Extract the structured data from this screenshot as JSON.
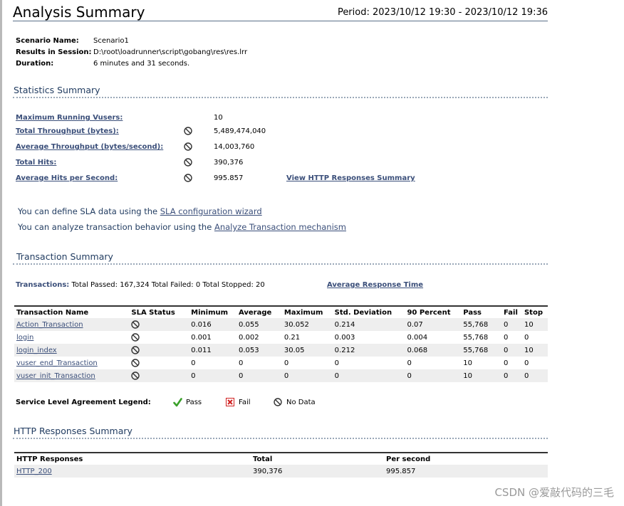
{
  "header": {
    "title": "Analysis Summary",
    "period": "Period: 2023/10/12 19:30 - 2023/10/12 19:36"
  },
  "scenario": {
    "name_label": "Scenario Name:",
    "name_value": "Scenario1",
    "session_label": "Results in Session:",
    "session_value": "D:\\root\\loadrunner\\script\\gobang\\res\\res.lrr",
    "duration_label": "Duration:",
    "duration_value": "6 minutes and 31 seconds."
  },
  "statistics": {
    "heading": "Statistics Summary",
    "items": [
      {
        "label": "Maximum Running Vusers:",
        "value": "10",
        "sla": false
      },
      {
        "label": "Total Throughput (bytes):",
        "value": "5,489,474,040",
        "sla": true
      },
      {
        "label": "Average Throughput (bytes/second):",
        "value": "14,003,760",
        "sla": true
      },
      {
        "label": "Total Hits:",
        "value": "390,376",
        "sla": true
      },
      {
        "label": "Average Hits per Second:",
        "value": "995.857",
        "sla": true
      }
    ],
    "http_link": "View HTTP Responses Summary"
  },
  "sla_info": {
    "line1_text": "You can define SLA data using the ",
    "line1_link": "SLA configuration wizard",
    "line2_text": "You can analyze transaction behavior using the ",
    "line2_link": "Analyze Transaction mechanism"
  },
  "transactions": {
    "heading": "Transaction Summary",
    "link": "Transactions:",
    "totals": " Total Passed: 167,324 Total Failed: 0 Total Stopped: 20",
    "avg_response_link": "Average Response Time",
    "columns": [
      "Transaction Name",
      "SLA Status",
      "Minimum",
      "Average",
      "Maximum",
      "Std. Deviation",
      "90 Percent",
      "Pass",
      "Fail",
      "Stop"
    ],
    "rows": [
      [
        "Action_Transaction",
        "",
        "0.016",
        "0.055",
        "30.052",
        "0.214",
        "0.07",
        "55,768",
        "0",
        "10"
      ],
      [
        "login",
        "",
        "0.001",
        "0.002",
        "0.21",
        "0.003",
        "0.004",
        "55,768",
        "0",
        "0"
      ],
      [
        "login_index",
        "",
        "0.011",
        "0.053",
        "30.05",
        "0.212",
        "0.068",
        "55,768",
        "0",
        "10"
      ],
      [
        "vuser_end_Transaction",
        "",
        "0",
        "0",
        "0",
        "0",
        "0",
        "10",
        "0",
        "0"
      ],
      [
        "vuser_init_Transaction",
        "",
        "0",
        "0",
        "0",
        "0",
        "0",
        "10",
        "0",
        "0"
      ]
    ]
  },
  "legend": {
    "title": "Service Level Agreement Legend:",
    "pass": "Pass",
    "fail": "Fail",
    "nodata": "No Data"
  },
  "http": {
    "heading": "HTTP Responses Summary",
    "columns": [
      "HTTP Responses",
      "Total",
      "Per second"
    ],
    "rows": [
      [
        "HTTP_200",
        "390,376",
        "995.857"
      ]
    ]
  },
  "watermark": "CSDN @爱敲代码的三毛",
  "colors": {
    "link": "#3b4f7a",
    "heading": "#1f3a5f",
    "pass_green": "#3aa02a",
    "fail_red": "#d02020"
  }
}
